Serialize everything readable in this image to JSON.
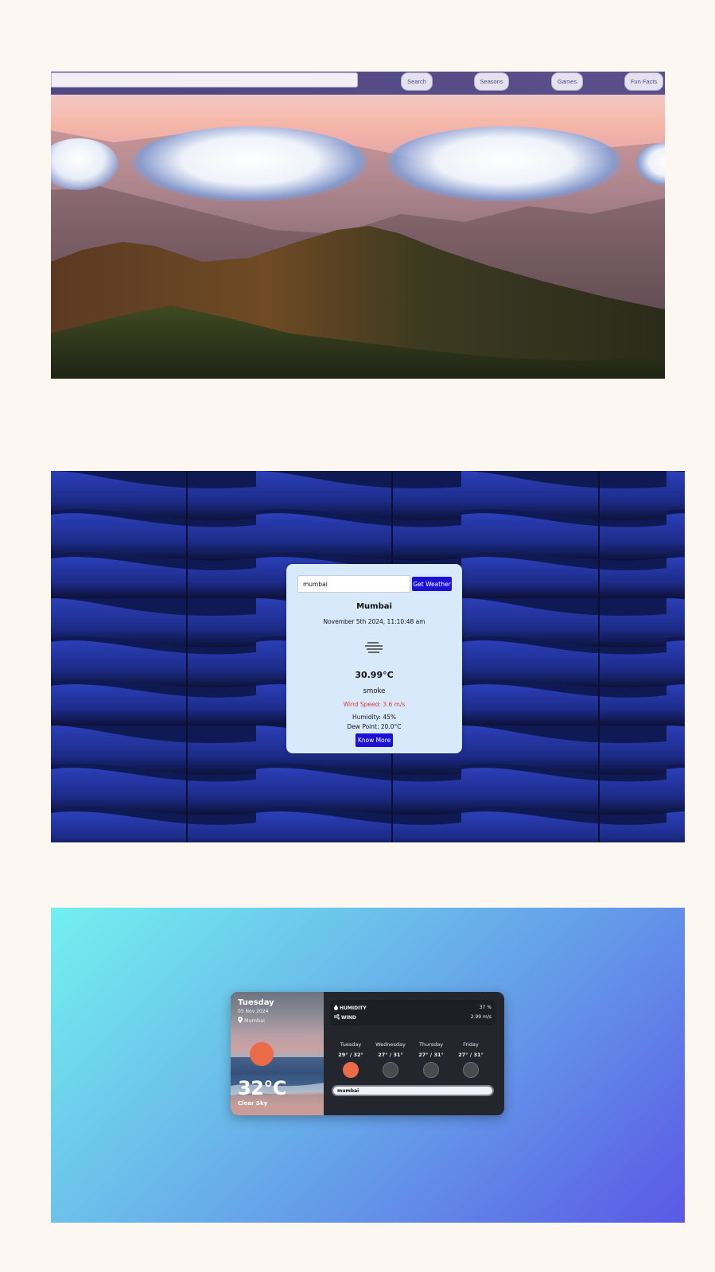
{
  "header": {
    "search_value": "",
    "nav": [
      "Search",
      "Seasons",
      "Games",
      "Fun Facts"
    ]
  },
  "weather_card": {
    "input_value": "mumbai",
    "button_label": "Get Weather",
    "city": "Mumbai",
    "datetime": "November 5th 2024, 11:10:48 am",
    "icon": "haze-icon",
    "temperature": "30.99°C",
    "condition": "smoke",
    "wind": "Wind Speed: 3.6 m/s",
    "humidity": "Humidity: 45%",
    "dew_point": "Dew Point: 20.0°C",
    "more_button": "Know More",
    "colors": {
      "accent": "#1c10d8",
      "wind": "#e23b3b",
      "card": "#d7e9fb"
    }
  },
  "forecast_widget": {
    "day": "Tuesday",
    "date": "05 Nov 2024",
    "location": "Mumbai",
    "temperature": "32°C",
    "condition": "Clear Sky",
    "humidity_label": "HUMIDITY",
    "humidity_value": "37 %",
    "wind_label": "WIND",
    "wind_value": "2.99 m/s",
    "forecast": [
      {
        "day": "Tuesday",
        "temp": "29° / 32°",
        "active": true
      },
      {
        "day": "Wednesday",
        "temp": "27° / 31°",
        "active": false
      },
      {
        "day": "Thursday",
        "temp": "27° / 31°",
        "active": false
      },
      {
        "day": "Friday",
        "temp": "27° / 31°",
        "active": false
      }
    ],
    "search_value": "mumbai",
    "colors": {
      "sun": "#ea6b48",
      "panel": "#23262d"
    }
  }
}
